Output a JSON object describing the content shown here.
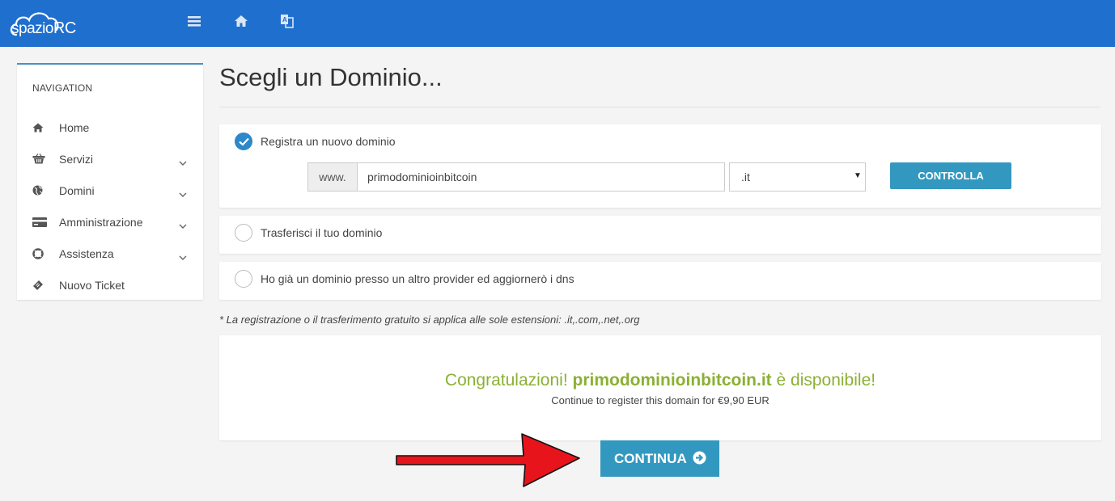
{
  "header": {
    "logo_text_a": "spazio",
    "logo_text_b": "RC",
    "icons": [
      "menu-icon",
      "home-icon",
      "translate-icon"
    ]
  },
  "sidebar": {
    "heading": "NAVIGATION",
    "items": [
      {
        "label": "Home",
        "icon": "home-icon",
        "expandable": false
      },
      {
        "label": "Servizi",
        "icon": "basket-icon",
        "expandable": true
      },
      {
        "label": "Domini",
        "icon": "globe-icon",
        "expandable": true
      },
      {
        "label": "Amministrazione",
        "icon": "credit-card-icon",
        "expandable": true
      },
      {
        "label": "Assistenza",
        "icon": "lifebuoy-icon",
        "expandable": true
      },
      {
        "label": "Nuovo Ticket",
        "icon": "ticket-icon",
        "expandable": false
      }
    ]
  },
  "main": {
    "title": "Scegli un Dominio...",
    "options": [
      {
        "label": "Registra un nuovo dominio",
        "checked": true
      },
      {
        "label": "Trasferisci il tuo dominio",
        "checked": false
      },
      {
        "label": "Ho già un dominio presso un altro provider ed aggiornerò i dns",
        "checked": false
      }
    ],
    "register": {
      "prefix": "www.",
      "domain_value": "primodominioinbitcoin",
      "tld_selected": ".it",
      "check_label": "CONTROLLA"
    },
    "note": "* La registrazione o il trasferimento gratuito si applica alle sole estensioni: .it,.com,.net,.org",
    "result": {
      "congrats_prefix": "Congratulazioni!",
      "domain_full": "primodominioinbitcoin.it",
      "congrats_suffix": "è disponibile!",
      "price_text": "Continue to register this domain for €9,90 EUR"
    },
    "continue_label": "CONTINUA"
  },
  "colors": {
    "header_bg": "#1f6fce",
    "accent_button": "#3398bf",
    "success_text": "#8bb034",
    "arrow": "#e8141c"
  }
}
